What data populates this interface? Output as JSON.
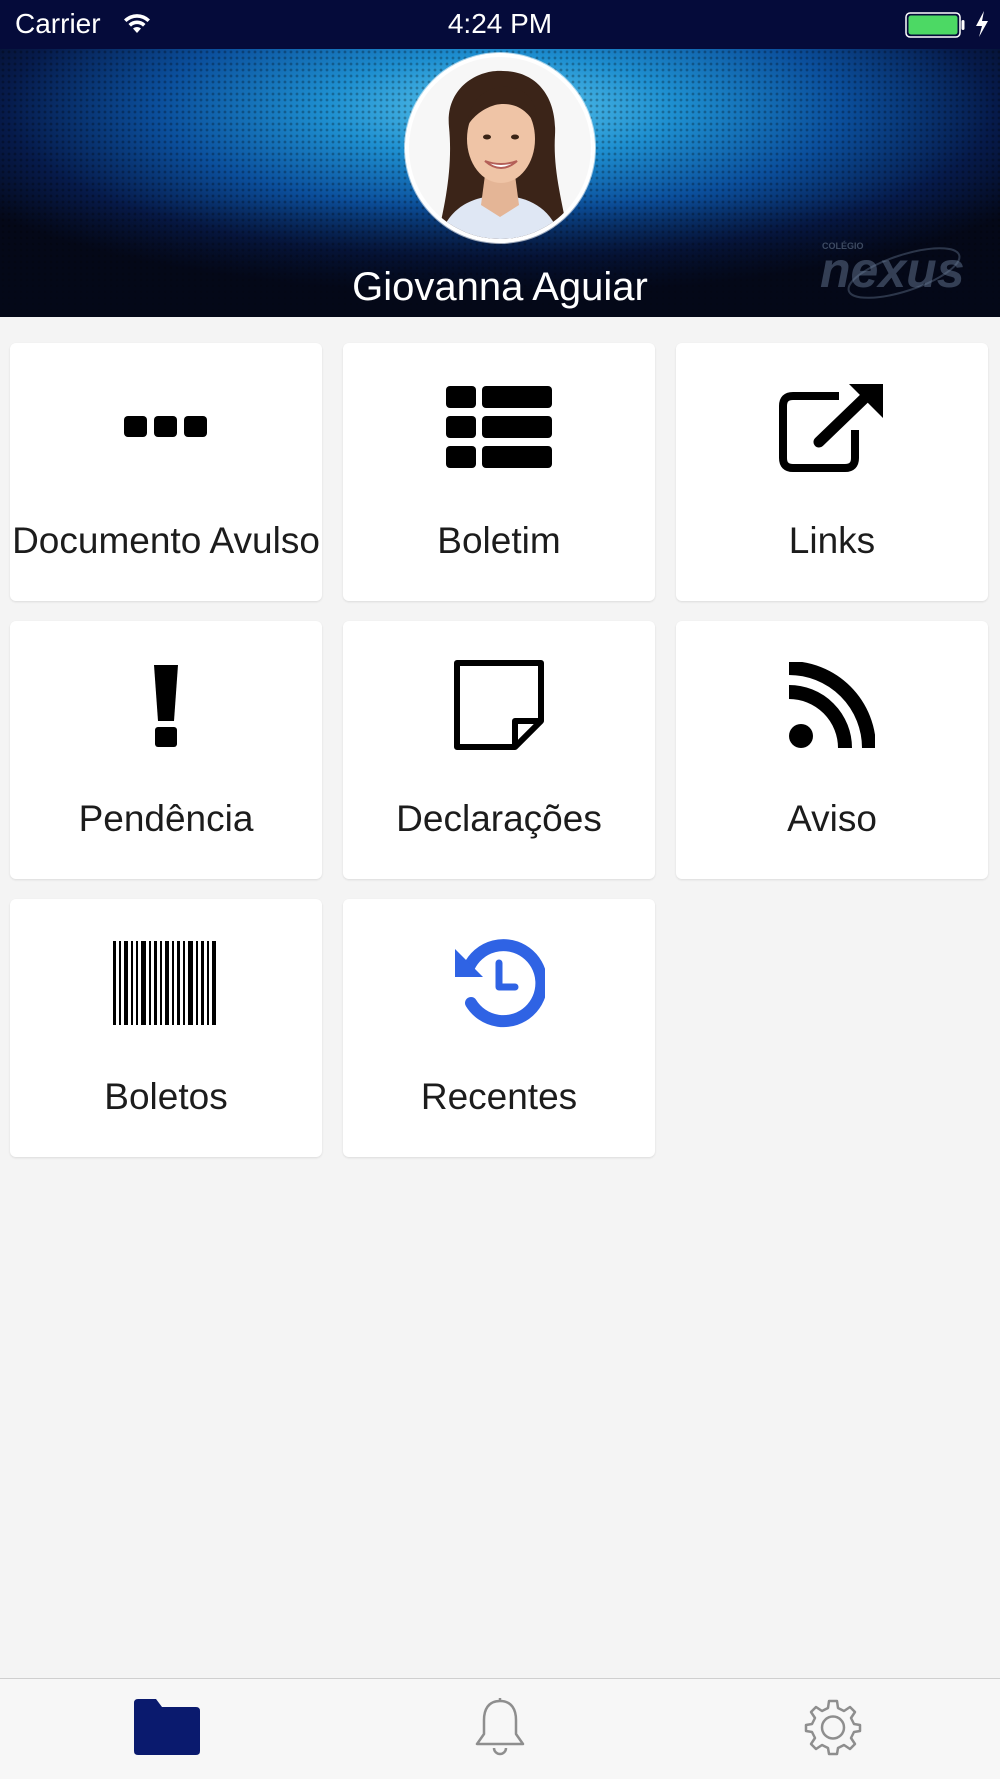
{
  "status_bar": {
    "carrier": "Carrier",
    "time": "4:24 PM"
  },
  "header": {
    "user_name": "Giovanna Aguiar",
    "logo_text": "nexus",
    "logo_small_text": "COLÉGIO"
  },
  "menu": [
    {
      "label": "Documento Avulso",
      "icon": "ellipsis-icon"
    },
    {
      "label": "Boletim",
      "icon": "list-icon"
    },
    {
      "label": "Links",
      "icon": "external-link-icon"
    },
    {
      "label": "Pendência",
      "icon": "exclamation-icon"
    },
    {
      "label": "Declarações",
      "icon": "sticky-note-icon"
    },
    {
      "label": "Aviso",
      "icon": "rss-icon"
    },
    {
      "label": "Boletos",
      "icon": "barcode-icon"
    },
    {
      "label": "Recentes",
      "icon": "history-icon"
    }
  ],
  "tab_bar": {
    "tabs": [
      {
        "name": "folder-icon",
        "active": true
      },
      {
        "name": "bell-icon",
        "active": false
      },
      {
        "name": "gear-icon",
        "active": false
      }
    ]
  },
  "colors": {
    "status_bar_bg": "#050b3a",
    "active_tab": "#0a1a6e",
    "inactive_tab": "#8e8e8e",
    "recent_icon": "#2f63e4",
    "battery": "#4cd964"
  }
}
